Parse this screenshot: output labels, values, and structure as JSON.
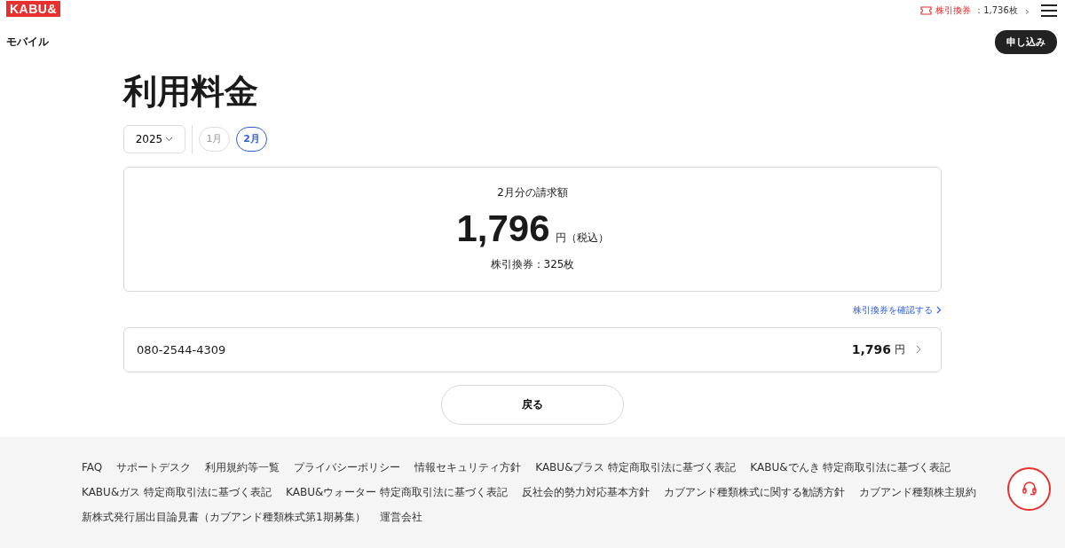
{
  "header": {
    "logo": "KABU&",
    "ticket_label": "株引換券",
    "ticket_value": "：1,736枚",
    "chevron": "›",
    "section": "モバイル",
    "apply_button": "申し込み"
  },
  "title": "利用料金",
  "year_select": {
    "value": "2025"
  },
  "months": [
    {
      "label": "1月",
      "selected": false
    },
    {
      "label": "2月",
      "selected": true
    }
  ],
  "summary": {
    "heading": "2月分の請求額",
    "amount": "1,796",
    "unit": "円（税込）",
    "tickets": "株引換券：325枚"
  },
  "confirm_link": "株引換券を確認する",
  "lines": [
    {
      "number": "080-2544-4309",
      "amount": "1,796",
      "unit": "円"
    }
  ],
  "back_button": "戻る",
  "footer": {
    "links": [
      "FAQ",
      "サポートデスク",
      "利用規約等一覧",
      "プライバシーポリシー",
      "情報セキュリティ方針",
      "KABU&プラス 特定商取引法に基づく表記",
      "KABU&でんき 特定商取引法に基づく表記",
      "KABU&ガス 特定商取引法に基づく表記",
      "KABU&ウォーター 特定商取引法に基づく表記",
      "反社会的勢力対応基本方針",
      "カブアンド種類株式に関する勧誘方針",
      "カブアンド種類株主規約",
      "新株式発行届出目論見書（カブアンド種類株式第1期募集）",
      "運営会社"
    ]
  }
}
